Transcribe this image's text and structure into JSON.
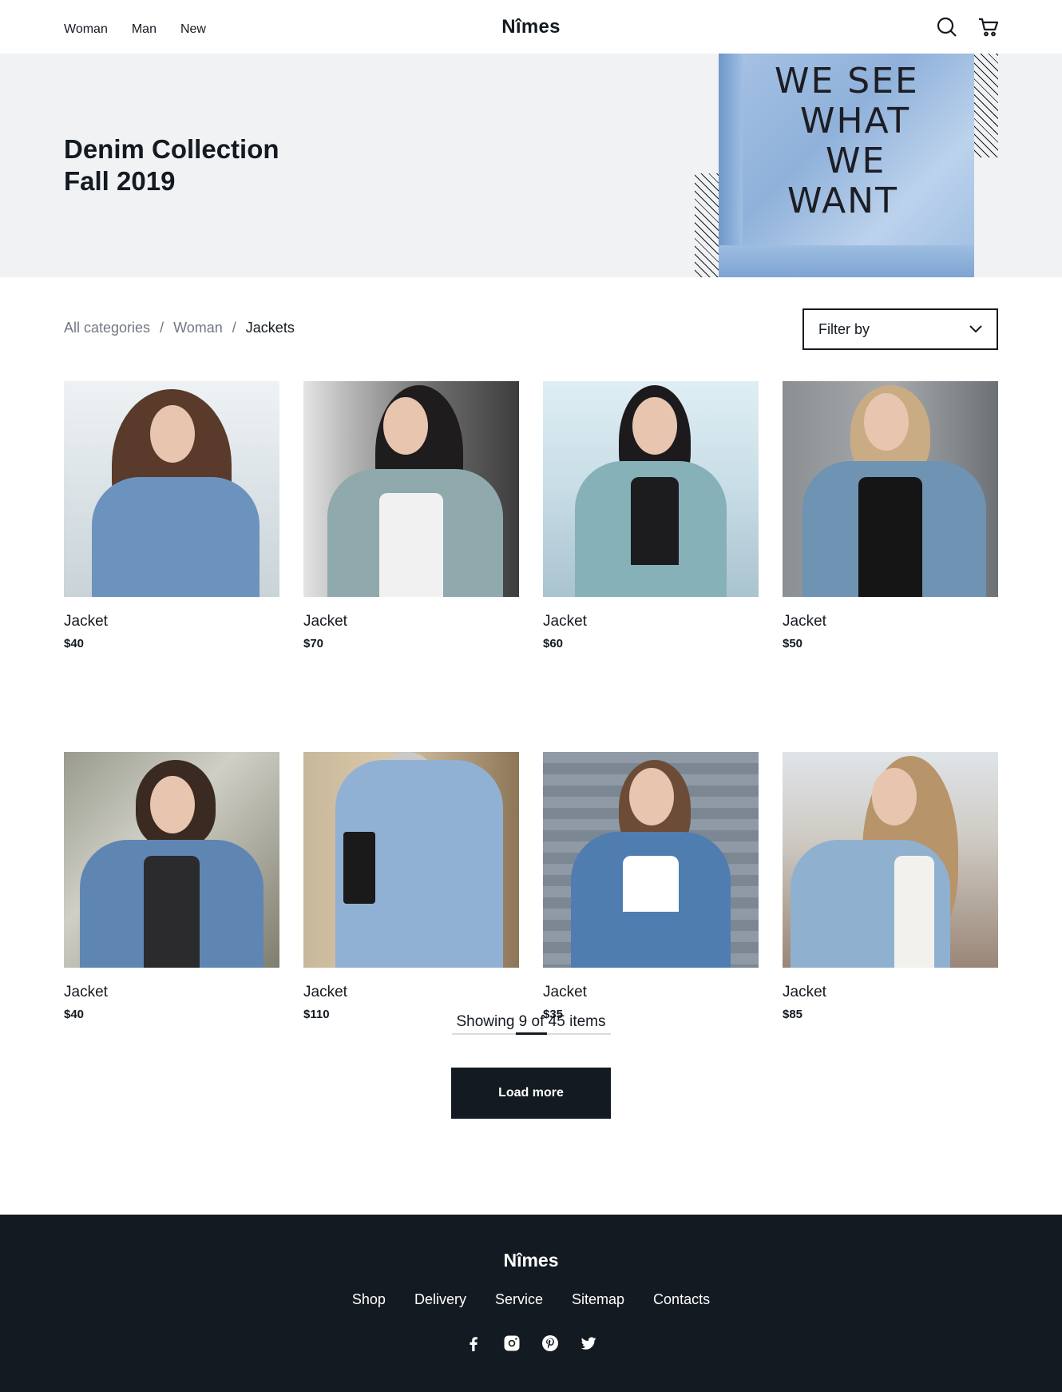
{
  "header": {
    "nav": [
      "Woman",
      "Man",
      "New"
    ],
    "logo": "Nîmes",
    "icons": [
      "search-icon",
      "cart-icon"
    ]
  },
  "hero": {
    "title_line1": "Denim Collection",
    "title_line2": "Fall 2019",
    "image_text": "WE SEE\n  WHAT\n    WE\n WANT"
  },
  "breadcrumb": {
    "items": [
      "All categories",
      "Woman",
      "Jackets"
    ],
    "separator": "/"
  },
  "filter": {
    "label": "Filter by"
  },
  "products": [
    {
      "name": "Jacket",
      "price": "$40"
    },
    {
      "name": "Jacket",
      "price": "$70"
    },
    {
      "name": "Jacket",
      "price": "$60"
    },
    {
      "name": "Jacket",
      "price": "$50"
    },
    {
      "name": "Jacket",
      "price": "$40"
    },
    {
      "name": "Jacket",
      "price": "$110"
    },
    {
      "name": "Jacket",
      "price": "$35"
    },
    {
      "name": "Jacket",
      "price": "$85"
    }
  ],
  "pagination": {
    "showing_prefix": "Showing",
    "shown": "9",
    "of": "of",
    "total": "45",
    "suffix": "items",
    "progress_fraction": 0.2,
    "load_more_label": "Load more"
  },
  "footer": {
    "logo": "Nîmes",
    "links": [
      "Shop",
      "Delivery",
      "Service",
      "Sitemap",
      "Contacts"
    ],
    "social_icons": [
      "facebook-icon",
      "instagram-icon",
      "pinterest-icon",
      "twitter-icon"
    ]
  },
  "colors": {
    "primary": "#141a21",
    "hero_bg": "#f1f2f4",
    "muted_text": "#717882",
    "denim": "#8fb1da"
  }
}
